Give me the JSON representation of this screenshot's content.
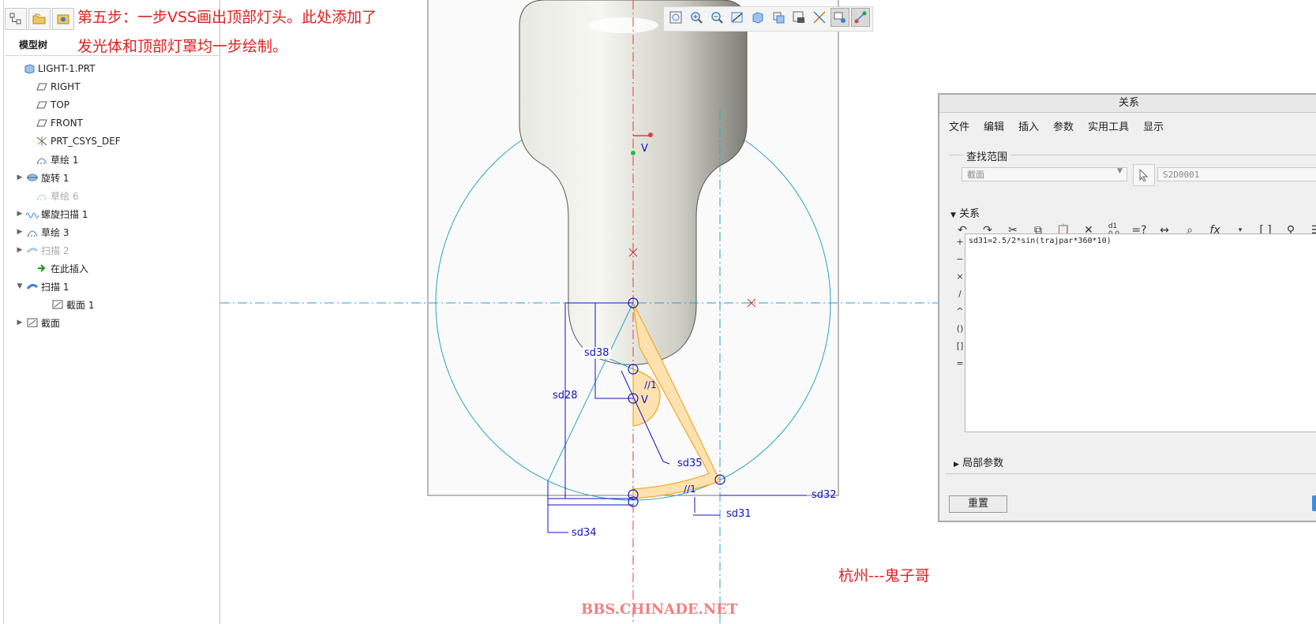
{
  "caption": {
    "line1": "第五步：一步VSS画出顶部灯头。此处添加了",
    "line2": "发光体和顶部灯罩均一步绘制。"
  },
  "model_tree": {
    "tab_label": "模型树",
    "items": [
      {
        "label": "LIGHT-1.PRT",
        "icon": "part-icon",
        "expand": "",
        "dim": false
      },
      {
        "label": "RIGHT",
        "icon": "datum-plane-icon",
        "expand": "",
        "dim": false
      },
      {
        "label": "TOP",
        "icon": "datum-plane-icon",
        "expand": "",
        "dim": false
      },
      {
        "label": "FRONT",
        "icon": "datum-plane-icon",
        "expand": "",
        "dim": false
      },
      {
        "label": "PRT_CSYS_DEF",
        "icon": "csys-icon",
        "expand": "",
        "dim": false
      },
      {
        "label": "草绘 1",
        "icon": "sketch-icon",
        "expand": "",
        "dim": false
      },
      {
        "label": "旋转 1",
        "icon": "revolve-icon",
        "expand": "▶",
        "dim": false
      },
      {
        "label": "草绘 6",
        "icon": "sketch-icon",
        "expand": "",
        "dim": true
      },
      {
        "label": "螺旋扫描 1",
        "icon": "helical-sweep-icon",
        "expand": "▶",
        "dim": false
      },
      {
        "label": "草绘 3",
        "icon": "sketch-icon",
        "expand": "▶",
        "dim": false
      },
      {
        "label": "扫描 2",
        "icon": "sweep-icon",
        "expand": "▶",
        "dim": true
      },
      {
        "label": "在此插入",
        "icon": "insert-here-icon",
        "expand": "",
        "dim": false
      },
      {
        "label": "扫描 1",
        "icon": "sweep-icon",
        "expand": "▼",
        "dim": false
      },
      {
        "label": "截面 1",
        "icon": "section-icon",
        "expand": "",
        "dim": false
      },
      {
        "label": "截面",
        "icon": "section-icon",
        "expand": "▶",
        "dim": false
      }
    ]
  },
  "view_toolbar": {
    "buttons": [
      "refit-icon",
      "zoom-in-icon",
      "zoom-out-icon",
      "repaint-icon",
      "display-style-icon",
      "saved-views-icon",
      "view-manager-icon",
      "datum-display-icon",
      "annotation-display-icon",
      "sketch-display-icon"
    ]
  },
  "sketch": {
    "vertex_label_top": "V",
    "vertex_label_mid": "V",
    "constraint_1": "//1",
    "constraint_2": "//1",
    "dims": {
      "sd38": "sd38",
      "sd28": "sd28",
      "sd35": "sd35",
      "sd32": "sd32",
      "sd31": "sd31",
      "sd34": "sd34"
    }
  },
  "relations_dialog": {
    "title": "关系",
    "menu": [
      "文件",
      "编辑",
      "插入",
      "参数",
      "实用工具",
      "显示"
    ],
    "scope_label": "查找范围",
    "scope_type": "截面",
    "scope_value": "S2D0001",
    "relations_label": "关系",
    "operators": [
      "+",
      "−",
      "×",
      "/",
      "^",
      "()",
      "[]",
      "="
    ],
    "relation_text": "sd31=2.5/2*sin(trajpar*360*10)",
    "local_params_label": "局部参数",
    "reset_label": "重置"
  },
  "author": "杭州---鬼子哥",
  "watermark": "BBS.CHINADE.NET",
  "colors": {
    "caption_red": "#e02020",
    "dimension_blue": "#1212c8",
    "construction_cyan": "#29a3c4",
    "section_orange": "#f5a623",
    "section_fill": "#fde2b0"
  }
}
